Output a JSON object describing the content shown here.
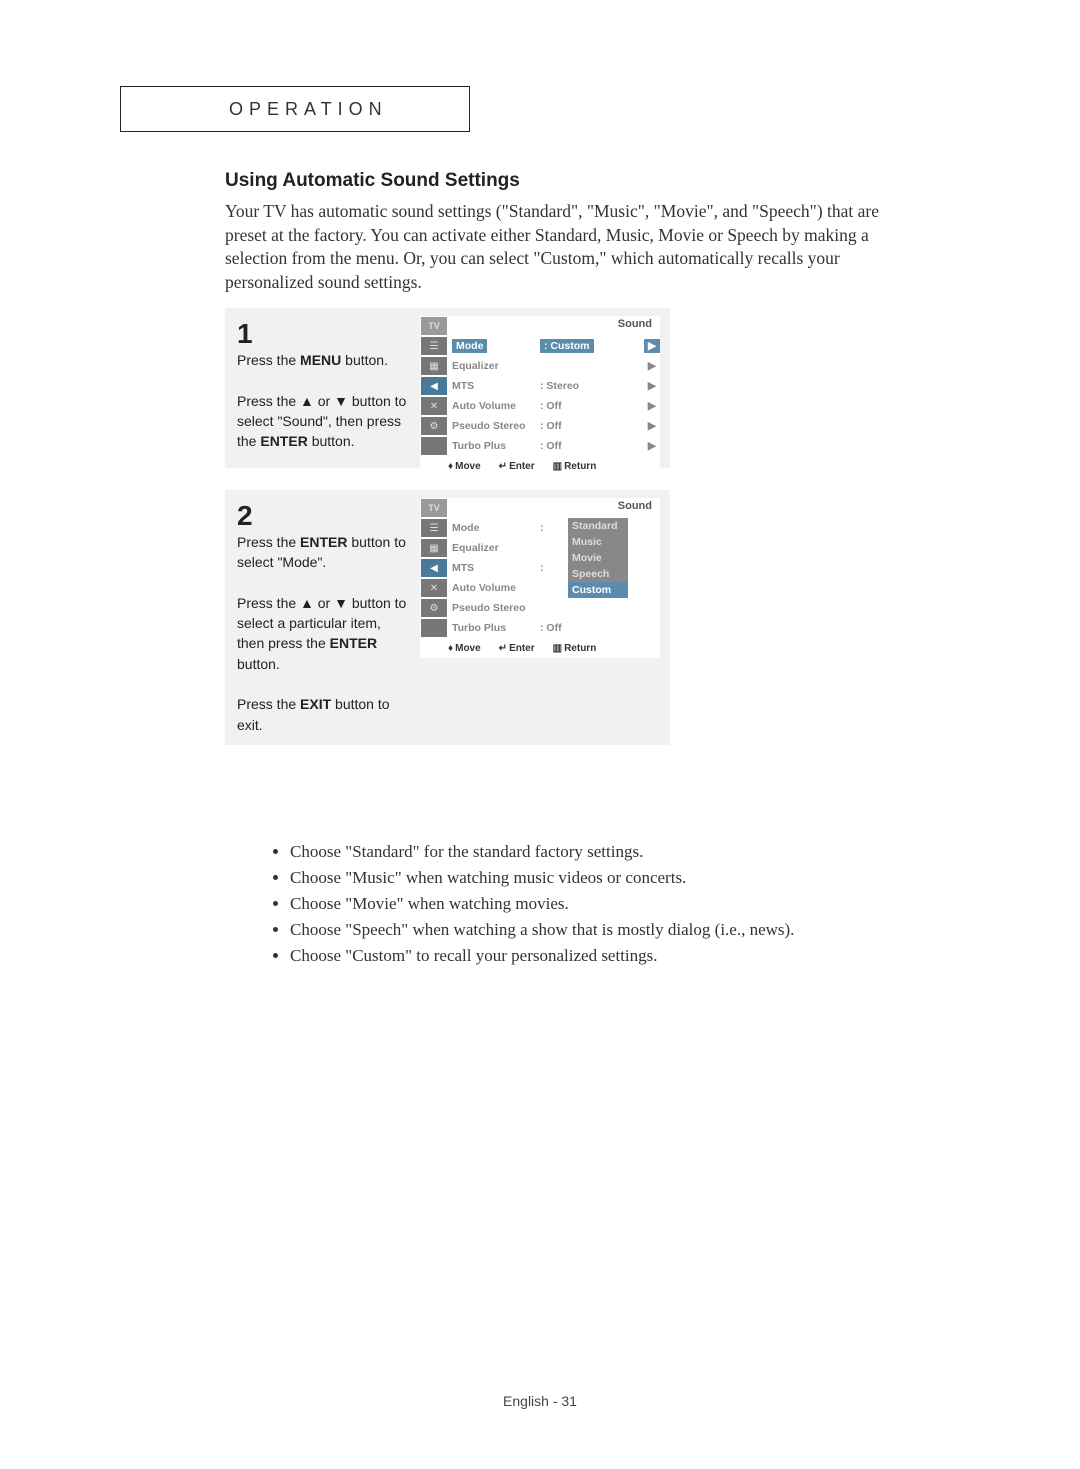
{
  "header": "OPERATION",
  "heading": "Using Automatic Sound Settings",
  "body": "Your TV has automatic sound settings (\"Standard\", \"Music\", \"Movie\", and \"Speech\") that are preset at the factory.  You can activate either Standard, Music, Movie or Speech by making a selection from the menu. Or, you can select \"Custom,\" which automatically recalls your personalized sound settings.",
  "step1": {
    "num": "1",
    "p1a": "Press the ",
    "p1b": "MENU",
    "p1c": " button.",
    "p2": "Press the ▲ or ▼ button to select \"Sound\", then press the ",
    "p2b": "ENTER",
    "p2c": " button."
  },
  "step2": {
    "num": "2",
    "p1a": "Press the ",
    "p1b": "ENTER",
    "p1c": " button to select \"Mode\".",
    "p2": "Press the ▲ or ▼ button to select a particular item, then press the ",
    "p2b": "ENTER",
    "p2c": " button.",
    "p3a": "Press the ",
    "p3b": "EXIT",
    "p3c": " button to exit."
  },
  "osd1": {
    "title": "Sound",
    "tv": "TV",
    "items": [
      {
        "label": "Mode",
        "value": ":  Custom",
        "selected": true
      },
      {
        "label": "Equalizer",
        "value": ""
      },
      {
        "label": "MTS",
        "value": ":  Stereo"
      },
      {
        "label": "Auto Volume",
        "value": ":  Off"
      },
      {
        "label": "Pseudo Stereo",
        "value": ":  Off"
      },
      {
        "label": "Turbo Plus",
        "value": ":  Off"
      }
    ],
    "footer": {
      "move": "Move",
      "enter": "Enter",
      "return": "Return"
    }
  },
  "osd2": {
    "title": "Sound",
    "tv": "TV",
    "items": [
      {
        "label": "Mode",
        "value": ":"
      },
      {
        "label": "Equalizer",
        "value": ""
      },
      {
        "label": "MTS",
        "value": ":"
      },
      {
        "label": "Auto Volume",
        "value": ""
      },
      {
        "label": "Pseudo Stereo",
        "value": ""
      },
      {
        "label": "Turbo Plus",
        "value": ":  Off"
      }
    ],
    "dropdown": [
      "Standard",
      "Music",
      "Movie",
      "Speech",
      "Custom"
    ],
    "dropdown_selected": "Custom",
    "footer": {
      "move": "Move",
      "enter": "Enter",
      "return": "Return"
    }
  },
  "bullets": [
    "Choose \"Standard\" for the standard factory settings.",
    "Choose \"Music\" when watching music videos or concerts.",
    "Choose \"Movie\" when watching movies.",
    "Choose \"Speech\" when watching a show that is mostly dialog (i.e., news).",
    "Choose \"Custom\" to recall your personalized settings."
  ],
  "footer": "English - 31"
}
